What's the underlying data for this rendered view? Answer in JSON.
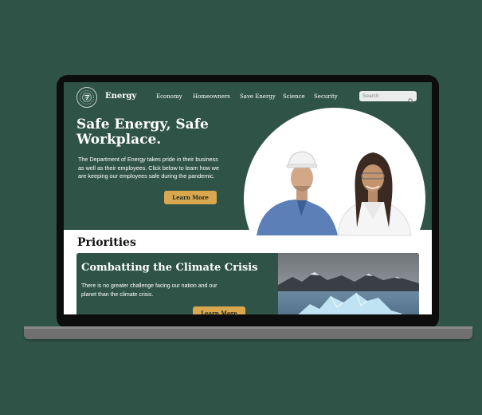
{
  "site": {
    "brand": "Energy",
    "logo_icon": "department-seal-icon"
  },
  "nav": {
    "items": [
      {
        "label": "Economy"
      },
      {
        "label": "Homeowners"
      },
      {
        "label": "Save Energy"
      },
      {
        "label": "Science"
      },
      {
        "label": "Security"
      }
    ],
    "search_placeholder": "Search",
    "search_icon": "search-icon"
  },
  "hero": {
    "title": "Safe Energy, Safe Workplace.",
    "body": "The Department of Energy takes pride in their business as well as their employees. Click below to learn how we are keeping our employees safe during the pandemic.",
    "button_label": "Learn More"
  },
  "priorities": {
    "heading": "Priorities",
    "card": {
      "title": "Combatting the Climate Crisis",
      "body": "There is no greater challenge facing our nation and our planet than the climate crisis.",
      "button_label": "Learn More"
    }
  },
  "colors": {
    "background": "#2f5447",
    "brand_green": "#2f5447",
    "accent_gold": "#d8a74e",
    "device_frame": "#0d0d0d"
  }
}
